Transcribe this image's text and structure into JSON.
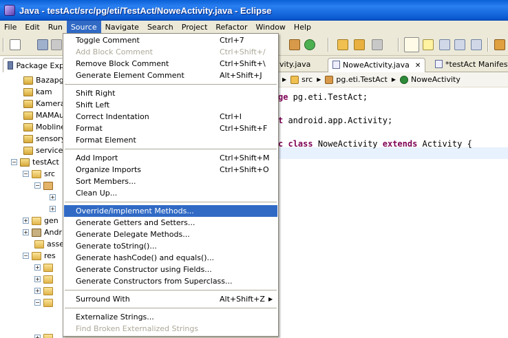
{
  "window": {
    "title": "Java - testAct/src/pg/eti/TestAct/NoweActivity.java - Eclipse"
  },
  "menubar": [
    "File",
    "Edit",
    "Run",
    "Source",
    "Navigate",
    "Search",
    "Project",
    "Refactor",
    "Window",
    "Help"
  ],
  "package_explorer": {
    "tab_label": "Package Exp",
    "rows": [
      "Bazapga",
      "kam",
      "KameraA",
      "MAMAug",
      "MoblineA",
      "sensory",
      "service_",
      "testAct",
      "src",
      "gen",
      "Andr",
      "asse",
      "res"
    ]
  },
  "editor": {
    "tabs": [
      "vity.java",
      "NoweActivity.java",
      "*testAct Manifest"
    ],
    "breadcrumb": [
      "src",
      "pg.eti.TestAct",
      "NoweActivity"
    ],
    "code": {
      "l1_kw": "ge",
      "l1_rest": " pg.eti.TestAct;",
      "l2_kw": "t",
      "l2_rest": " android.app.Activity;",
      "l3_kw1": "c",
      "l3_kw2": "class",
      "l3_name": " NoweActivity ",
      "l3_kw3": "extends",
      "l3_rest": " Activity {"
    }
  },
  "source_menu": {
    "items": [
      {
        "label": "Toggle Comment",
        "accel": "Ctrl+7"
      },
      {
        "label": "Add Block Comment",
        "accel": "Ctrl+Shift+/"
      },
      {
        "label": "Remove Block Comment",
        "accel": "Ctrl+Shift+\\"
      },
      {
        "label": "Generate Element Comment",
        "accel": "Alt+Shift+J"
      },
      {
        "label": "Shift Right",
        "accel": ""
      },
      {
        "label": "Shift Left",
        "accel": ""
      },
      {
        "label": "Correct Indentation",
        "accel": "Ctrl+I"
      },
      {
        "label": "Format",
        "accel": "Ctrl+Shift+F"
      },
      {
        "label": "Format Element",
        "accel": ""
      },
      {
        "label": "Add Import",
        "accel": "Ctrl+Shift+M"
      },
      {
        "label": "Organize Imports",
        "accel": "Ctrl+Shift+O"
      },
      {
        "label": "Sort Members...",
        "accel": ""
      },
      {
        "label": "Clean Up...",
        "accel": ""
      },
      {
        "label": "Override/Implement Methods...",
        "accel": ""
      },
      {
        "label": "Generate Getters and Setters...",
        "accel": ""
      },
      {
        "label": "Generate Delegate Methods...",
        "accel": ""
      },
      {
        "label": "Generate toString()...",
        "accel": ""
      },
      {
        "label": "Generate hashCode() and equals()...",
        "accel": ""
      },
      {
        "label": "Generate Constructor using Fields...",
        "accel": ""
      },
      {
        "label": "Generate Constructors from Superclass...",
        "accel": ""
      },
      {
        "label": "Surround With",
        "accel": "Alt+Shift+Z"
      },
      {
        "label": "Externalize Strings...",
        "accel": ""
      },
      {
        "label": "Find Broken Externalized Strings",
        "accel": ""
      }
    ]
  }
}
